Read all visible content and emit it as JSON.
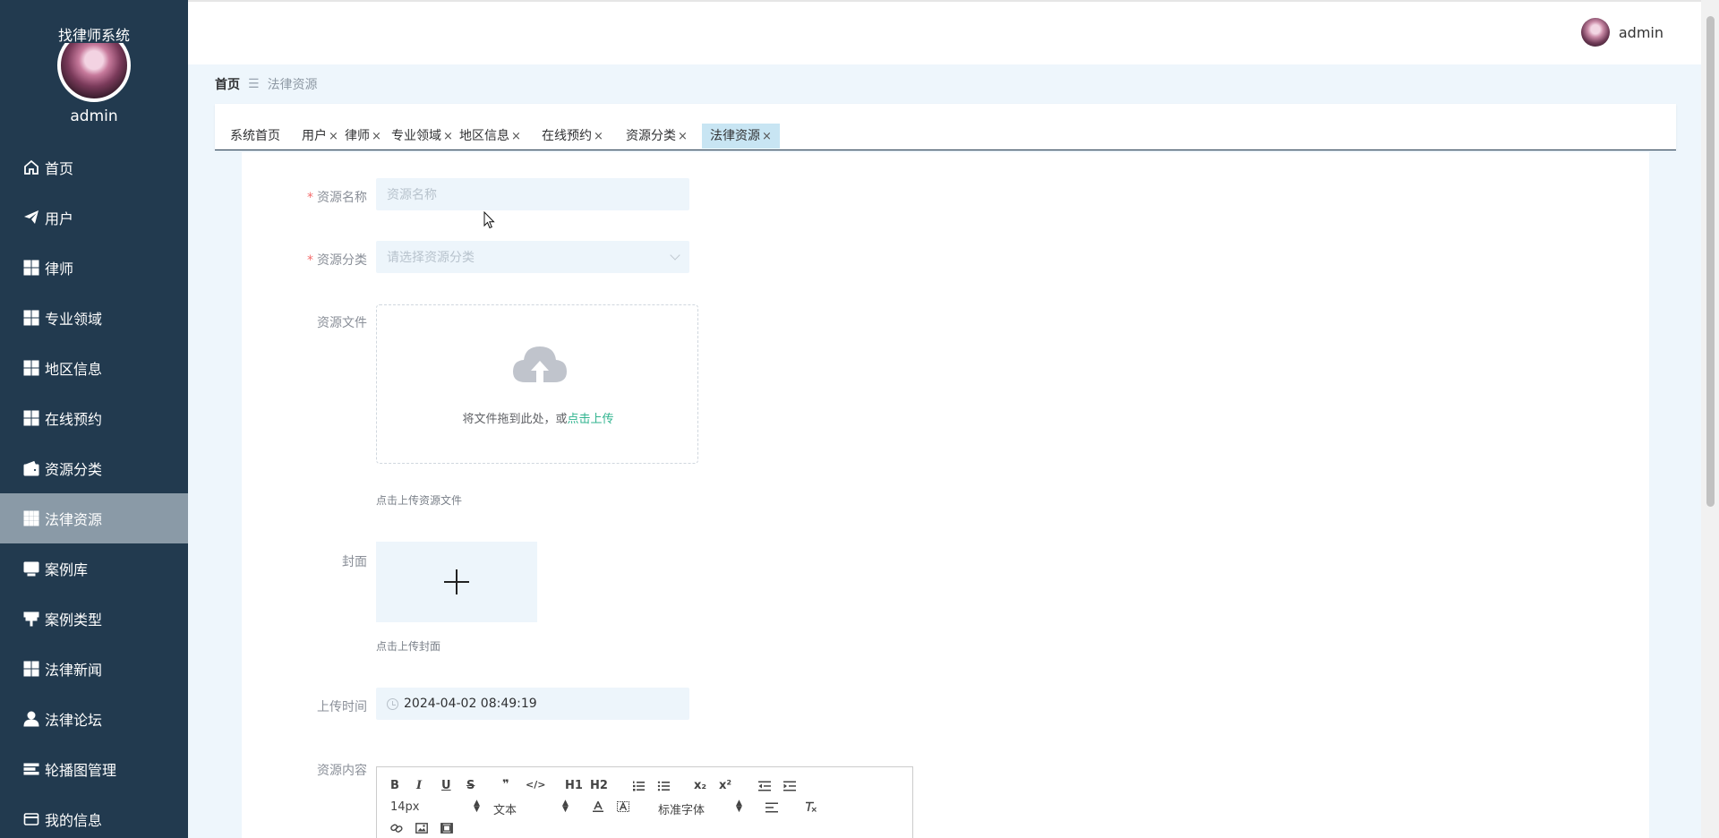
{
  "app": {
    "title": "找律师系统",
    "username": "admin"
  },
  "sidebar": {
    "items": [
      {
        "label": "首页",
        "icon": "home-icon"
      },
      {
        "label": "用户",
        "icon": "paper-plane-icon"
      },
      {
        "label": "律师",
        "icon": "grid-icon"
      },
      {
        "label": "专业领域",
        "icon": "grid-icon"
      },
      {
        "label": "地区信息",
        "icon": "grid-icon"
      },
      {
        "label": "在线预约",
        "icon": "grid-icon"
      },
      {
        "label": "资源分类",
        "icon": "wallet-icon"
      },
      {
        "label": "法律资源",
        "icon": "grid-nine-icon",
        "active": true
      },
      {
        "label": "案例库",
        "icon": "monitor-icon"
      },
      {
        "label": "案例类型",
        "icon": "pin-icon"
      },
      {
        "label": "法律新闻",
        "icon": "grid-icon"
      },
      {
        "label": "法律论坛",
        "icon": "user-icon"
      },
      {
        "label": "轮播图管理",
        "icon": "list-icon"
      },
      {
        "label": "我的信息",
        "icon": "card-icon"
      }
    ]
  },
  "header": {
    "username": "admin"
  },
  "breadcrumb": {
    "home": "首页",
    "separator": "☰",
    "current": "法律资源"
  },
  "tabs": [
    {
      "label": "系统首页",
      "closable": false
    },
    {
      "label": "用户",
      "closable": true
    },
    {
      "label": "律师",
      "closable": true
    },
    {
      "label": "专业领域",
      "closable": true
    },
    {
      "label": "地区信息",
      "closable": true
    },
    {
      "label": "在线预约",
      "closable": true
    },
    {
      "label": "资源分类",
      "closable": true
    },
    {
      "label": "法律资源",
      "closable": true,
      "active": true
    }
  ],
  "tab_close": "×",
  "form": {
    "name": {
      "label": "资源名称",
      "required_mark": "*",
      "placeholder": "资源名称"
    },
    "category": {
      "label": "资源分类",
      "required_mark": "*",
      "placeholder": "请选择资源分类"
    },
    "file": {
      "label": "资源文件",
      "drop_text": "将文件拖到此处，或",
      "drop_link": "点击上传",
      "tip": "点击上传资源文件"
    },
    "cover": {
      "label": "封面",
      "tip": "点击上传封面"
    },
    "upload_time": {
      "label": "上传时间",
      "value": "2024-04-02 08:49:19"
    },
    "content": {
      "label": "资源内容"
    }
  },
  "editor": {
    "buttons_row1": [
      "B",
      "I",
      "U",
      "S",
      "❞",
      "</>",
      "H1",
      "H2",
      "ol",
      "ul",
      "x₂",
      "x²",
      "outdent",
      "indent"
    ],
    "size": "14px",
    "header": "文本",
    "font": "标准字体",
    "select_arrows": "▲▼"
  },
  "colors": {
    "sidebar_bg": "#223a4f",
    "active_item": "#8a9aa7",
    "accent": "#2fb38e",
    "tab_active": "#c8e5f3",
    "required": "#f56c6c"
  }
}
